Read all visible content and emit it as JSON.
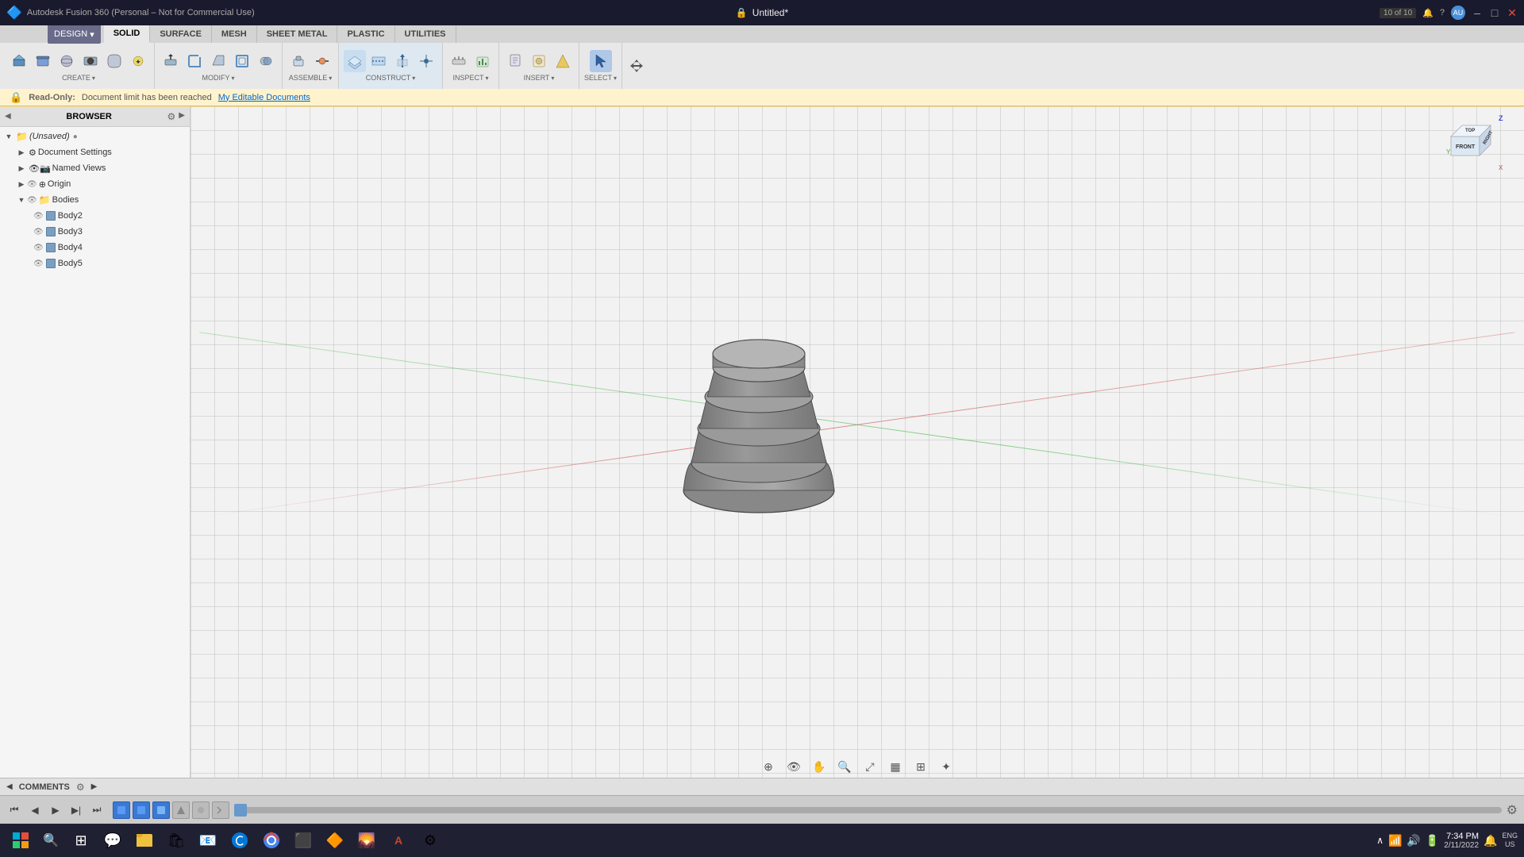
{
  "window": {
    "title": "Autodesk Fusion 360 (Personal – Not for Commercial Use)",
    "document_title": "Untitled*",
    "minimize": "–",
    "maximize": "□",
    "close": "✕"
  },
  "titlebar": {
    "app_name": "Autodesk Fusion 360 (Personal – Not for Commercial Use)",
    "doc_counter": "10 of 10",
    "plus_btn": "+",
    "close_tab": "✕"
  },
  "mode_tabs": [
    {
      "label": "SOLID",
      "active": true
    },
    {
      "label": "SURFACE",
      "active": false
    },
    {
      "label": "MESH",
      "active": false
    },
    {
      "label": "SHEET METAL",
      "active": false
    },
    {
      "label": "PLASTIC",
      "active": false
    },
    {
      "label": "UTILITIES",
      "active": false
    }
  ],
  "toolbar": {
    "design_label": "DESIGN",
    "sections": {
      "create": {
        "label": "CREATE",
        "has_arrow": true
      },
      "modify": {
        "label": "MODIFY",
        "has_arrow": true
      },
      "assemble": {
        "label": "ASSEMBLE",
        "has_arrow": true
      },
      "construct": {
        "label": "CONSTRUCT",
        "has_arrow": true
      },
      "inspect": {
        "label": "INSPECT",
        "has_arrow": true
      },
      "insert": {
        "label": "INSERT",
        "has_arrow": true
      },
      "select": {
        "label": "SELECT",
        "has_arrow": true
      }
    }
  },
  "readonly_bar": {
    "lock_icon": "🔒",
    "label": "Read-Only:",
    "message": "Document limit has been reached",
    "link": "My Editable Documents"
  },
  "browser": {
    "title": "BROWSER",
    "collapse_icon": "◀",
    "items": [
      {
        "id": "unsaved",
        "label": "(Unsaved)",
        "indent": 0,
        "arrow": "▶",
        "icon": "folder",
        "selected": false,
        "has_settings": true
      },
      {
        "id": "doc-settings",
        "label": "Document Settings",
        "indent": 1,
        "arrow": "▶",
        "icon": "gear",
        "selected": false
      },
      {
        "id": "named-views",
        "label": "Named Views",
        "indent": 1,
        "arrow": "▶",
        "icon": "camera",
        "selected": false
      },
      {
        "id": "origin",
        "label": "Origin",
        "indent": 1,
        "arrow": "▶",
        "icon": "origin",
        "selected": false
      },
      {
        "id": "bodies",
        "label": "Bodies",
        "indent": 1,
        "arrow": "▼",
        "icon": "folder",
        "selected": false,
        "expanded": true
      },
      {
        "id": "body2",
        "label": "Body2",
        "indent": 2,
        "arrow": "",
        "icon": "body",
        "selected": false,
        "has_eye": true
      },
      {
        "id": "body3",
        "label": "Body3",
        "indent": 2,
        "arrow": "",
        "icon": "body",
        "selected": false,
        "has_eye": true
      },
      {
        "id": "body4",
        "label": "Body4",
        "indent": 2,
        "arrow": "",
        "icon": "body",
        "selected": false,
        "has_eye": true
      },
      {
        "id": "body5",
        "label": "Body5",
        "indent": 2,
        "arrow": "",
        "icon": "body",
        "selected": false,
        "has_eye": true
      }
    ]
  },
  "viewport": {
    "axis": {
      "x_label": "X",
      "y_label": "Y",
      "z_label": "Z"
    },
    "viewcube": {
      "front": "FRONT",
      "right": "RIGHT",
      "top": "TOP"
    }
  },
  "statusbar": {
    "comments": "COMMENTS",
    "settings_icon": "⚙"
  },
  "timeline": {
    "play_first": "⏮",
    "play_prev": "◀",
    "play": "▶",
    "play_next": "▶|",
    "play_last": "⏭"
  },
  "taskbar": {
    "time": "7:34 PM",
    "date": "2/11/2022",
    "locale": "ENG\nUS",
    "start_icon": "⊞"
  }
}
